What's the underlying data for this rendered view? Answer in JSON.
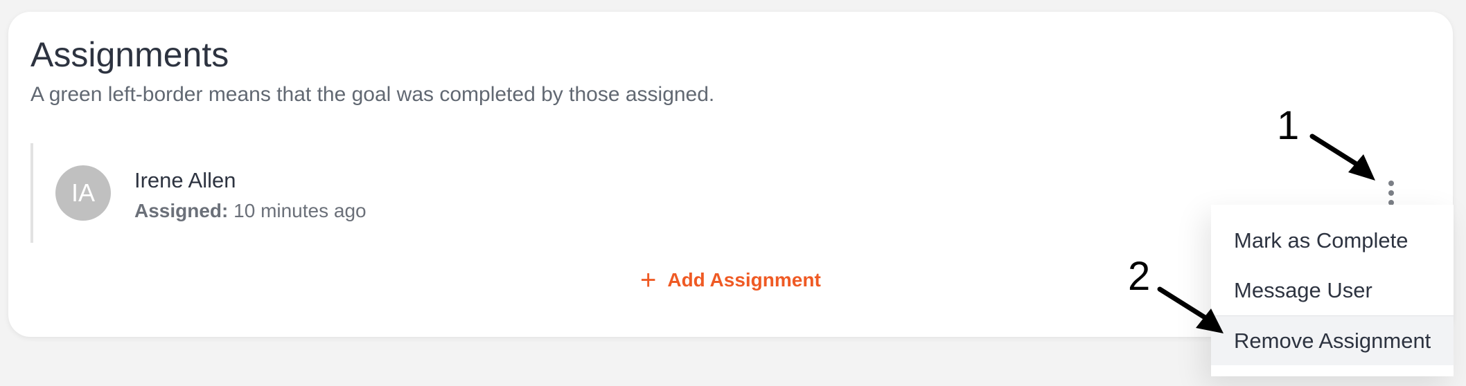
{
  "header": {
    "title": "Assignments",
    "subtitle": "A green left-border means that the goal was completed by those assigned."
  },
  "assignment": {
    "initials": "IA",
    "name": "Irene Allen",
    "assigned_label": "Assigned:",
    "assigned_time": "10 minutes ago"
  },
  "add_button": {
    "icon": "plus-icon",
    "label": "Add Assignment"
  },
  "more_button": {
    "icon": "kebab-menu-icon"
  },
  "menu": {
    "items": [
      {
        "label": "Mark as Complete"
      },
      {
        "label": "Message User"
      },
      {
        "label": "Remove Assignment"
      }
    ]
  },
  "annotations": {
    "step_1": "1",
    "step_2": "2"
  },
  "colors": {
    "accent": "#ef5a24",
    "avatar_bg": "#c0c0c0",
    "text_primary": "#2d3340",
    "text_secondary": "#616872"
  }
}
